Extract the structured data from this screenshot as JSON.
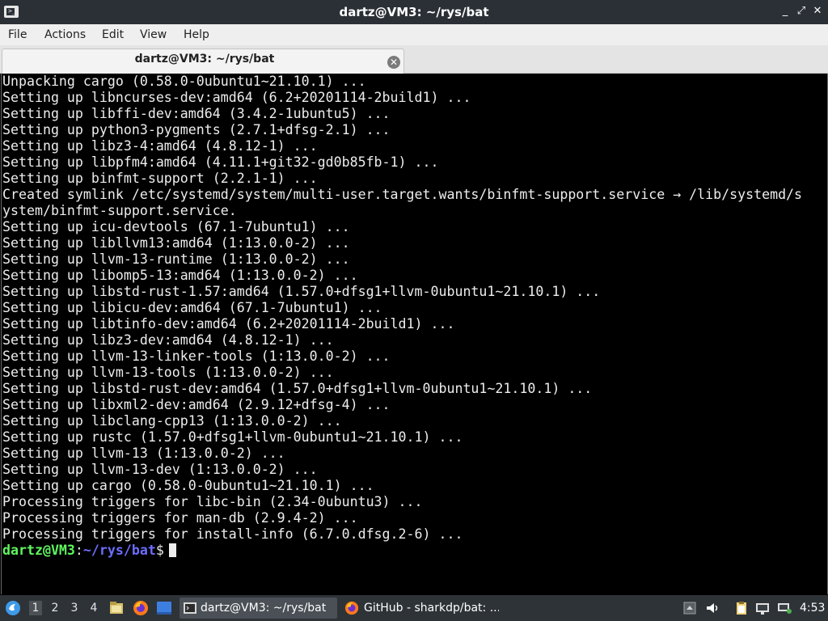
{
  "window": {
    "title": "dartz@VM3: ~/rys/bat",
    "controls": {
      "minimize": "_",
      "maximize": "⤢",
      "close": "✕"
    }
  },
  "menu": {
    "items": [
      "File",
      "Actions",
      "Edit",
      "View",
      "Help"
    ]
  },
  "tabs": [
    {
      "label": "dartz@VM3: ~/rys/bat",
      "close": "✕"
    }
  ],
  "terminal": {
    "lines": [
      "Unpacking cargo (0.58.0-0ubuntu1~21.10.1) ...",
      "Setting up libncurses-dev:amd64 (6.2+20201114-2build1) ...",
      "Setting up libffi-dev:amd64 (3.4.2-1ubuntu5) ...",
      "Setting up python3-pygments (2.7.1+dfsg-2.1) ...",
      "Setting up libz3-4:amd64 (4.8.12-1) ...",
      "Setting up libpfm4:amd64 (4.11.1+git32-gd0b85fb-1) ...",
      "Setting up binfmt-support (2.2.1-1) ...",
      "Created symlink /etc/systemd/system/multi-user.target.wants/binfmt-support.service → /lib/systemd/s",
      "ystem/binfmt-support.service.",
      "Setting up icu-devtools (67.1-7ubuntu1) ...",
      "Setting up libllvm13:amd64 (1:13.0.0-2) ...",
      "Setting up llvm-13-runtime (1:13.0.0-2) ...",
      "Setting up libomp5-13:amd64 (1:13.0.0-2) ...",
      "Setting up libstd-rust-1.57:amd64 (1.57.0+dfsg1+llvm-0ubuntu1~21.10.1) ...",
      "Setting up libicu-dev:amd64 (67.1-7ubuntu1) ...",
      "Setting up libtinfo-dev:amd64 (6.2+20201114-2build1) ...",
      "Setting up libz3-dev:amd64 (4.8.12-1) ...",
      "Setting up llvm-13-linker-tools (1:13.0.0-2) ...",
      "Setting up llvm-13-tools (1:13.0.0-2) ...",
      "Setting up libstd-rust-dev:amd64 (1.57.0+dfsg1+llvm-0ubuntu1~21.10.1) ...",
      "Setting up libxml2-dev:amd64 (2.9.12+dfsg-4) ...",
      "Setting up libclang-cpp13 (1:13.0.0-2) ...",
      "Setting up rustc (1.57.0+dfsg1+llvm-0ubuntu1~21.10.1) ...",
      "Setting up llvm-13 (1:13.0.0-2) ...",
      "Setting up llvm-13-dev (1:13.0.0-2) ...",
      "Setting up cargo (0.58.0-0ubuntu1~21.10.1) ...",
      "Processing triggers for libc-bin (2.34-0ubuntu3) ...",
      "Processing triggers for man-db (2.9.4-2) ...",
      "Processing triggers for install-info (6.7.0.dfsg.2-6) ..."
    ],
    "prompt": {
      "user": "dartz@VM3",
      "sep": ":",
      "path": "~/rys/bat",
      "symbol": "$"
    },
    "colors": {
      "background": "#000000",
      "text": "#ededed",
      "prompt_user": "#5ff55f",
      "prompt_path": "#6d6dff"
    }
  },
  "taskbar": {
    "workspaces": [
      "1",
      "2",
      "3",
      "4"
    ],
    "active_workspace": "1",
    "tasks": [
      {
        "label": "dartz@VM3: ~/rys/bat",
        "icon": "terminal-icon",
        "active": true
      },
      {
        "label": "GitHub - sharkdp/bat: ...",
        "icon": "firefox-icon",
        "active": false
      }
    ],
    "clock": "4:53"
  }
}
